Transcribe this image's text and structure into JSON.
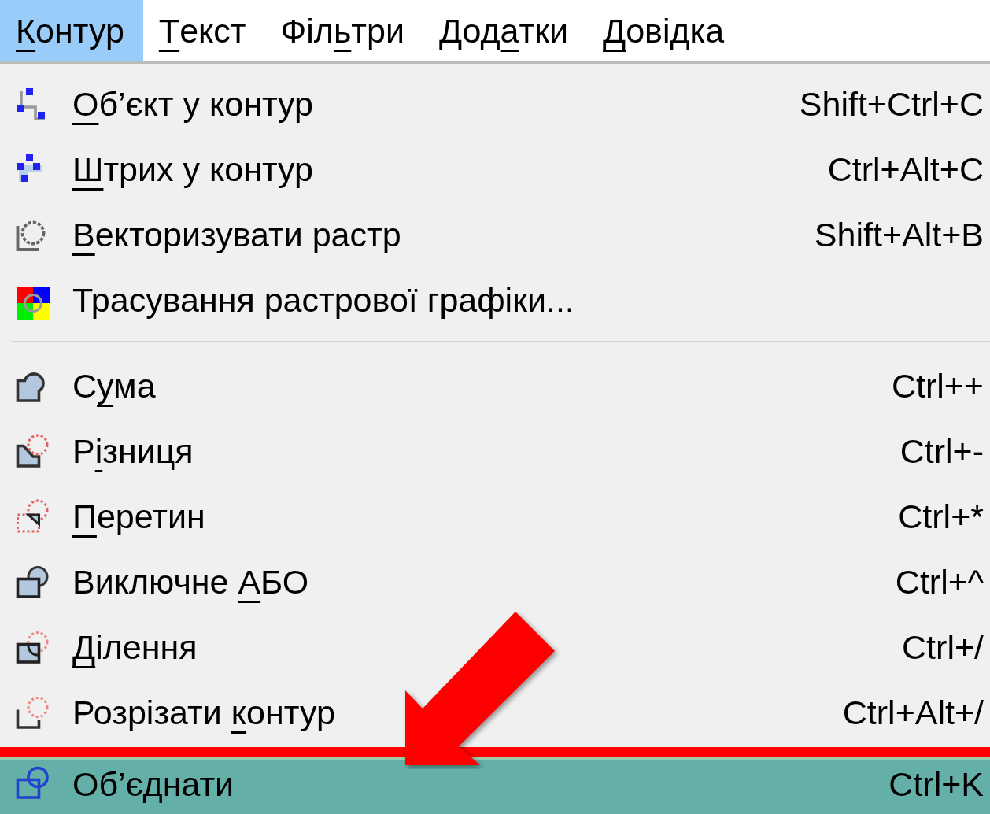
{
  "menubar": [
    {
      "label": [
        {
          "text": "К",
          "kind": "access_key"
        },
        {
          "text": "онтур",
          "kind": "plain"
        }
      ],
      "selected": true
    },
    {
      "label": [
        {
          "text": "Т",
          "kind": "access_key"
        },
        {
          "text": "екст",
          "kind": "plain"
        }
      ],
      "selected": false
    },
    {
      "label": [
        {
          "text": "Філ",
          "kind": "plain"
        },
        {
          "text": "ь",
          "kind": "access_key"
        },
        {
          "text": "три",
          "kind": "plain"
        }
      ],
      "selected": false
    },
    {
      "label": [
        {
          "text": "Дод",
          "kind": "plain"
        },
        {
          "text": "а",
          "kind": "access_key"
        },
        {
          "text": "тки",
          "kind": "plain"
        }
      ],
      "selected": false
    },
    {
      "label": [
        {
          "text": "Д",
          "kind": "access_key"
        },
        {
          "text": "овідка",
          "kind": "plain"
        }
      ],
      "selected": false
    }
  ],
  "menu": [
    {
      "kind": "item",
      "label": [
        {
          "text": "О",
          "kind": "access_key"
        },
        {
          "text": "б’єкт у контур",
          "kind": "plain"
        }
      ],
      "shortcut": "Shift+Ctrl+C",
      "selected": false
    },
    {
      "kind": "item",
      "label": [
        {
          "text": "Ш",
          "kind": "access_key"
        },
        {
          "text": "трих у контур",
          "kind": "plain"
        }
      ],
      "shortcut": "Ctrl+Alt+C",
      "selected": false
    },
    {
      "kind": "item",
      "label": [
        {
          "text": "В",
          "kind": "access_key"
        },
        {
          "text": "екторизувати растр",
          "kind": "plain"
        }
      ],
      "shortcut": "Shift+Alt+B",
      "selected": false
    },
    {
      "kind": "item",
      "label": [
        {
          "text": "Трасування растрової графіки...",
          "kind": "plain"
        }
      ],
      "selected": false
    },
    {
      "kind": "separator"
    },
    {
      "kind": "item",
      "label": [
        {
          "text": "С",
          "kind": "plain"
        },
        {
          "text": "у",
          "kind": "access_key"
        },
        {
          "text": "ма",
          "kind": "plain"
        }
      ],
      "shortcut": "Ctrl++",
      "selected": false
    },
    {
      "kind": "item",
      "label": [
        {
          "text": "Р",
          "kind": "plain"
        },
        {
          "text": "і",
          "kind": "access_key"
        },
        {
          "text": "зниця",
          "kind": "plain"
        }
      ],
      "shortcut": "Ctrl+-",
      "selected": false
    },
    {
      "kind": "item",
      "label": [
        {
          "text": "П",
          "kind": "access_key"
        },
        {
          "text": "еретин",
          "kind": "plain"
        }
      ],
      "shortcut": "Ctrl+*",
      "selected": false
    },
    {
      "kind": "item",
      "label": [
        {
          "text": "Виключне ",
          "kind": "plain"
        },
        {
          "text": "А",
          "kind": "access_key"
        },
        {
          "text": "БО",
          "kind": "plain"
        }
      ],
      "shortcut": "Ctrl+^",
      "selected": false
    },
    {
      "kind": "item",
      "label": [
        {
          "text": "Д",
          "kind": "access_key"
        },
        {
          "text": "ілення",
          "kind": "plain"
        }
      ],
      "shortcut": "Ctrl+/",
      "selected": false
    },
    {
      "kind": "item",
      "label": [
        {
          "text": "Розрізати ",
          "kind": "plain"
        },
        {
          "text": "к",
          "kind": "access_key"
        },
        {
          "text": "онтур",
          "kind": "plain"
        }
      ],
      "shortcut": "Ctrl+Alt+/",
      "selected": false
    },
    {
      "kind": "item",
      "label": [
        {
          "text": "Об’єднати",
          "kind": "plain"
        }
      ],
      "shortcut": "Ctrl+K",
      "selected": true
    }
  ]
}
